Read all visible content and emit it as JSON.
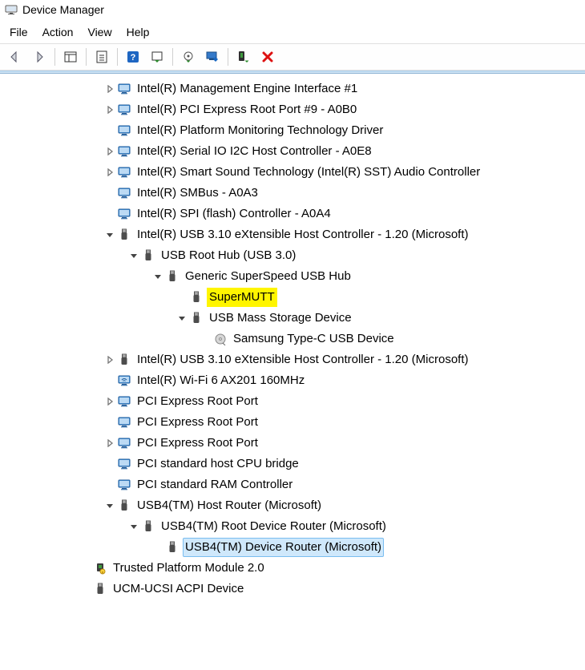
{
  "window": {
    "title": "Device Manager"
  },
  "menu": {
    "file": "File",
    "action": "Action",
    "view": "View",
    "help": "Help"
  },
  "tree": {
    "items": [
      {
        "indent": 0,
        "tw": "closed",
        "icon": "monitor",
        "label": "Intel(R) Management Engine Interface #1"
      },
      {
        "indent": 0,
        "tw": "closed",
        "icon": "monitor",
        "label": "Intel(R) PCI Express Root Port #9 - A0B0"
      },
      {
        "indent": 0,
        "tw": "none",
        "icon": "monitor",
        "label": "Intel(R) Platform Monitoring Technology Driver"
      },
      {
        "indent": 0,
        "tw": "closed",
        "icon": "monitor",
        "label": "Intel(R) Serial IO I2C Host Controller - A0E8"
      },
      {
        "indent": 0,
        "tw": "closed",
        "icon": "monitor",
        "label": "Intel(R) Smart Sound Technology (Intel(R) SST) Audio Controller"
      },
      {
        "indent": 0,
        "tw": "none",
        "icon": "monitor",
        "label": "Intel(R) SMBus - A0A3"
      },
      {
        "indent": 0,
        "tw": "none",
        "icon": "monitor",
        "label": "Intel(R) SPI (flash) Controller - A0A4"
      },
      {
        "indent": 0,
        "tw": "open",
        "icon": "usb",
        "label": "Intel(R) USB 3.10 eXtensible Host Controller - 1.20 (Microsoft)"
      },
      {
        "indent": 1,
        "tw": "open",
        "icon": "usb",
        "label": "USB Root Hub (USB 3.0)"
      },
      {
        "indent": 2,
        "tw": "open",
        "icon": "usb",
        "label": "Generic SuperSpeed USB Hub"
      },
      {
        "indent": 3,
        "tw": "none",
        "icon": "usb",
        "label": "SuperMUTT",
        "highlight": "yellow"
      },
      {
        "indent": 3,
        "tw": "open",
        "icon": "usb",
        "label": "USB Mass Storage Device"
      },
      {
        "indent": 4,
        "tw": "none",
        "icon": "disk",
        "label": "Samsung Type-C USB Device"
      },
      {
        "indent": 0,
        "tw": "closed",
        "icon": "usb",
        "label": "Intel(R) USB 3.10 eXtensible Host Controller - 1.20 (Microsoft)"
      },
      {
        "indent": 0,
        "tw": "none",
        "icon": "wifi",
        "label": "Intel(R) Wi-Fi 6 AX201 160MHz"
      },
      {
        "indent": 0,
        "tw": "closed",
        "icon": "monitor",
        "label": "PCI Express Root Port"
      },
      {
        "indent": 0,
        "tw": "none",
        "icon": "monitor",
        "label": "PCI Express Root Port"
      },
      {
        "indent": 0,
        "tw": "closed",
        "icon": "monitor",
        "label": "PCI Express Root Port"
      },
      {
        "indent": 0,
        "tw": "none",
        "icon": "monitor",
        "label": "PCI standard host CPU bridge"
      },
      {
        "indent": 0,
        "tw": "none",
        "icon": "monitor",
        "label": "PCI standard RAM Controller"
      },
      {
        "indent": 0,
        "tw": "open",
        "icon": "usb",
        "label": "USB4(TM) Host Router (Microsoft)"
      },
      {
        "indent": 1,
        "tw": "open",
        "icon": "usb",
        "label": "USB4(TM) Root Device Router (Microsoft)"
      },
      {
        "indent": 2,
        "tw": "none",
        "icon": "usb",
        "label": "USB4(TM) Device Router (Microsoft)",
        "highlight": "select"
      },
      {
        "indent": -1,
        "tw": "none",
        "icon": "tpm",
        "label": "Trusted Platform Module 2.0"
      },
      {
        "indent": -1,
        "tw": "none",
        "icon": "usb",
        "label": "UCM-UCSI ACPI Device"
      }
    ]
  }
}
